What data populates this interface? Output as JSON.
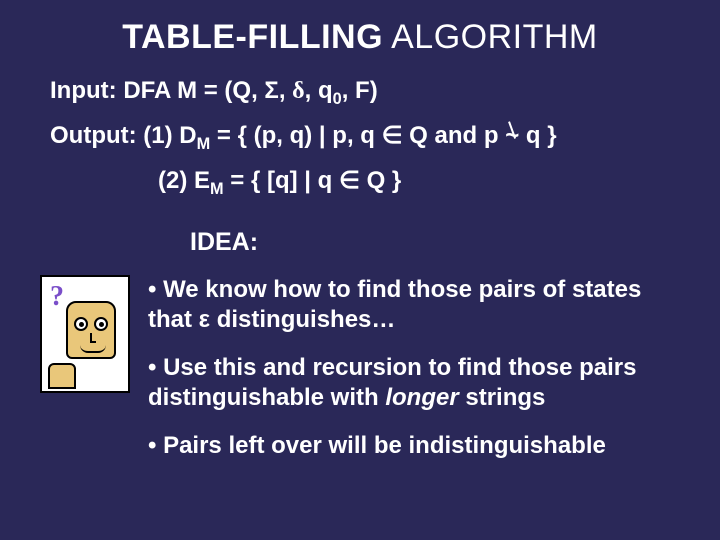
{
  "title": {
    "part1": "TABLE-FILLING",
    "part2": " ALGORITHM"
  },
  "input": {
    "label": "Input: ",
    "text_a": "DFA M = (Q, Σ, ",
    "delta": "δ",
    "text_b": ", q",
    "zero": "0",
    "text_c": ", F)"
  },
  "output": {
    "label": "Output:  ",
    "line1_a": "(1) D",
    "line1_sub": "M",
    "line1_b": " = { (p, q) | p, q ",
    "elem1": "∈",
    "line1_c": " Q and p ",
    "sim": "~",
    "line1_d": " q }",
    "line2_a": "(2) E",
    "line2_sub": "M",
    "line2_b": " = { [q] | q ",
    "elem2": "∈",
    "line2_c": " Q }"
  },
  "idea_label": "IDEA:",
  "bullets": {
    "b1": "• We know how to find those pairs of states that ε distinguishes…",
    "b2_a": "• Use this and recursion to find those pairs distinguishable with ",
    "b2_em": "longer",
    "b2_b": " strings",
    "b3": "• Pairs left over will be indistinguishable"
  }
}
